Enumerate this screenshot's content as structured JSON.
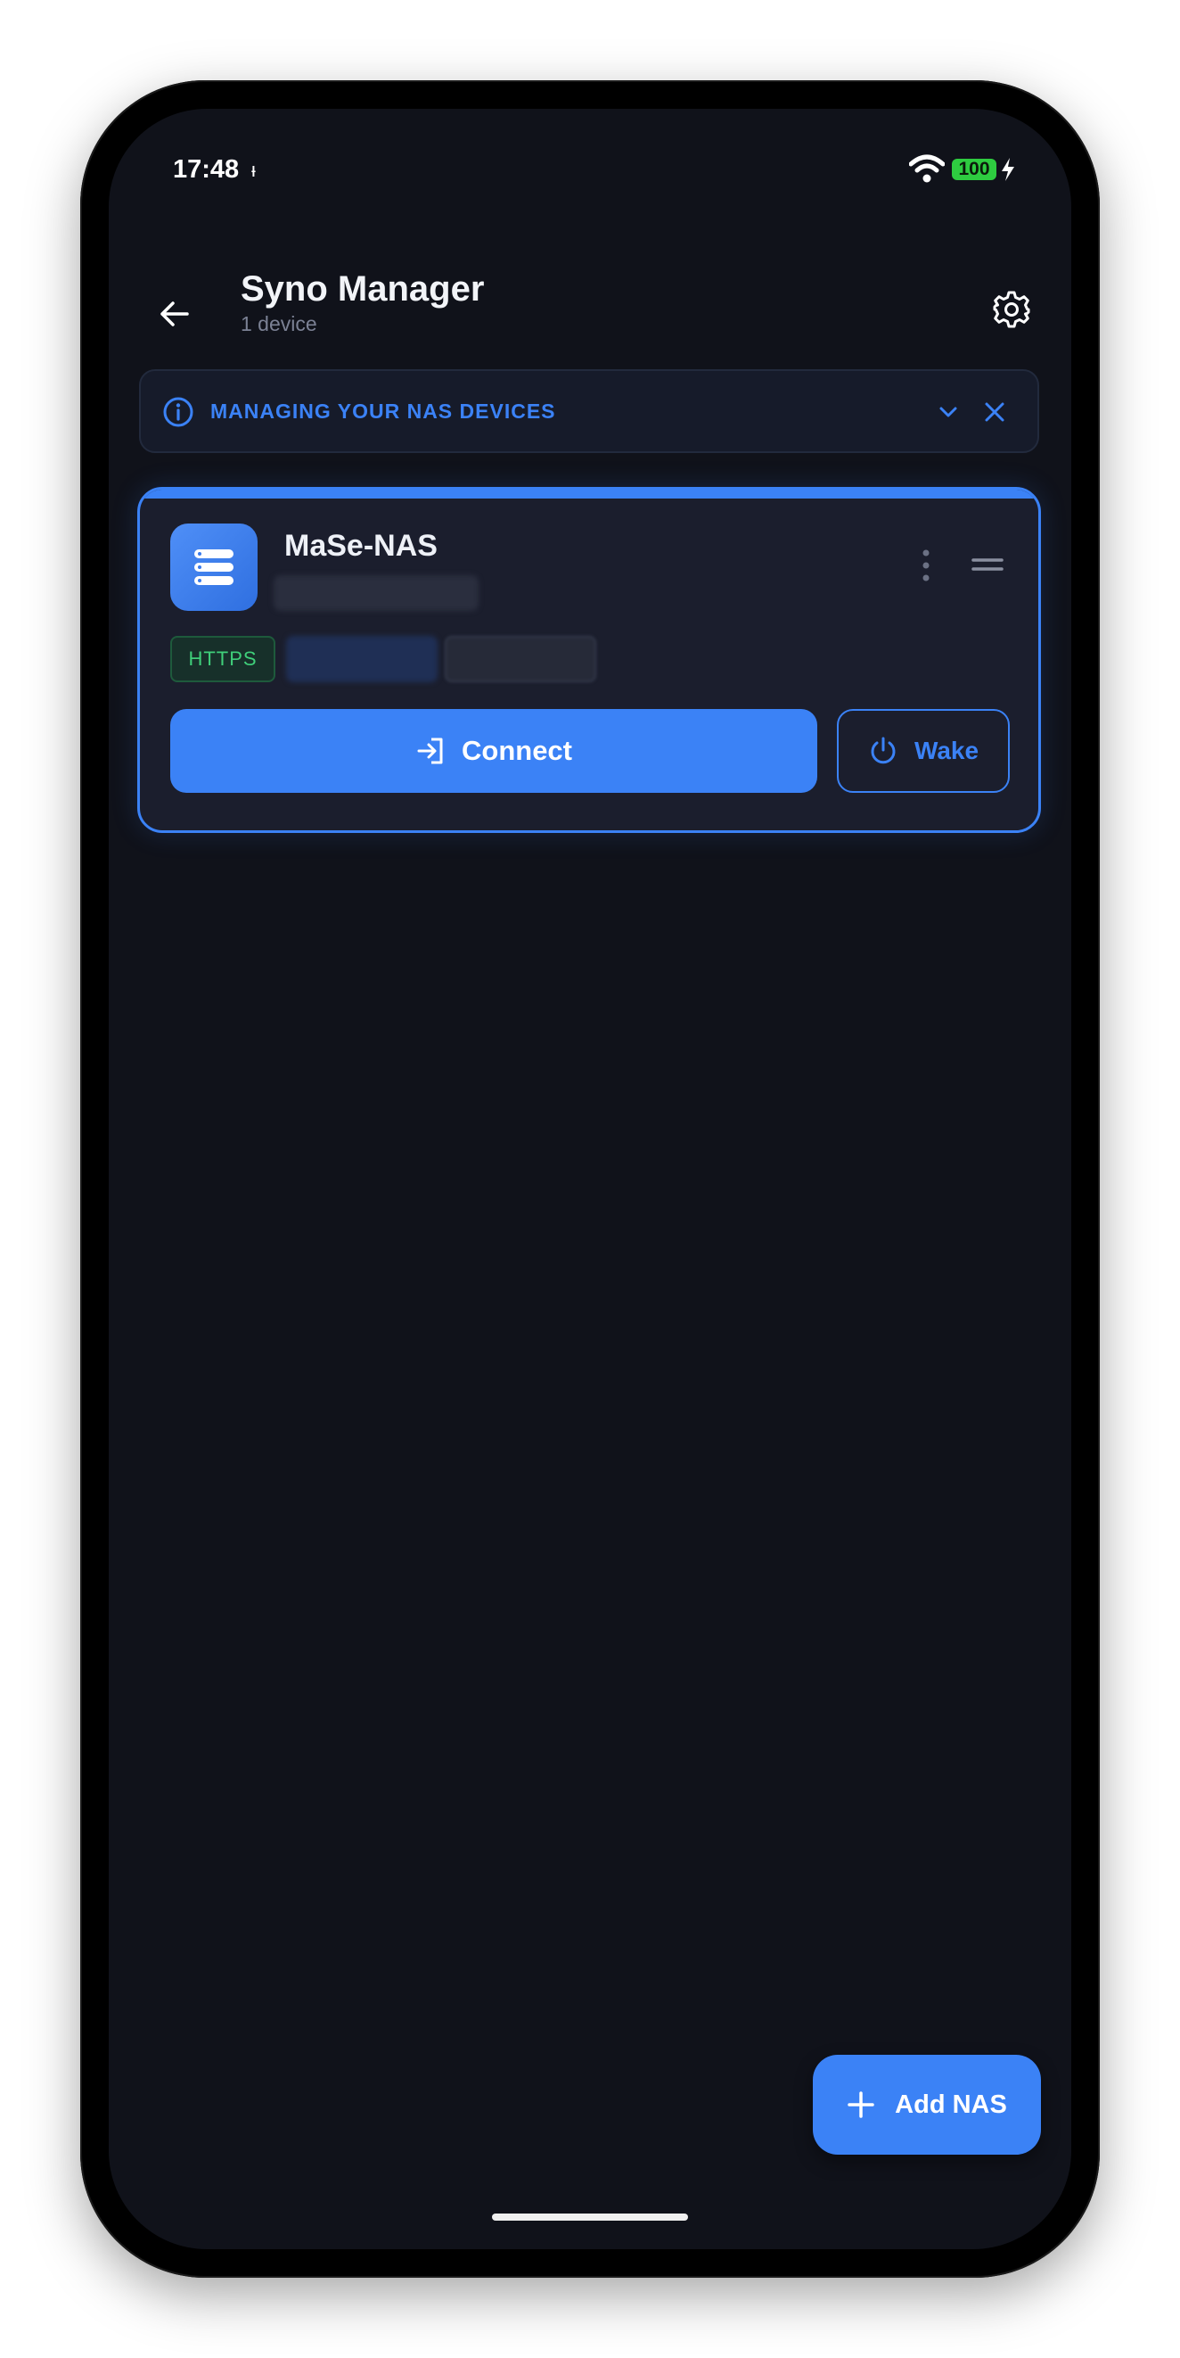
{
  "status_bar": {
    "time": "17:48",
    "time_extra": "ᵻ",
    "battery": "100",
    "icons": [
      "wifi-icon",
      "battery-icon",
      "charging-bolt-icon"
    ]
  },
  "header": {
    "title": "Syno Manager",
    "subtitle": "1 device",
    "back_icon": "arrow-left-icon",
    "settings_icon": "gear-icon"
  },
  "banner": {
    "text": "MANAGING YOUR NAS DEVICES",
    "icons": [
      "info-icon",
      "chevron-down-icon",
      "close-icon"
    ],
    "color": "#3b82f6"
  },
  "device_card": {
    "name": "MaSe-NAS",
    "protocol_tag": "HTTPS",
    "connect_label": "Connect",
    "wake_label": "Wake",
    "icons": [
      "server-icon",
      "more-vertical-icon",
      "drag-handle-icon",
      "login-icon",
      "power-icon"
    ]
  },
  "fab": {
    "label": "Add NAS",
    "icon": "plus-icon"
  },
  "colors": {
    "accent": "#3b82f6",
    "background": "#10121a",
    "card": "#1b1e2d",
    "https_tag": "#3fcf7a"
  }
}
